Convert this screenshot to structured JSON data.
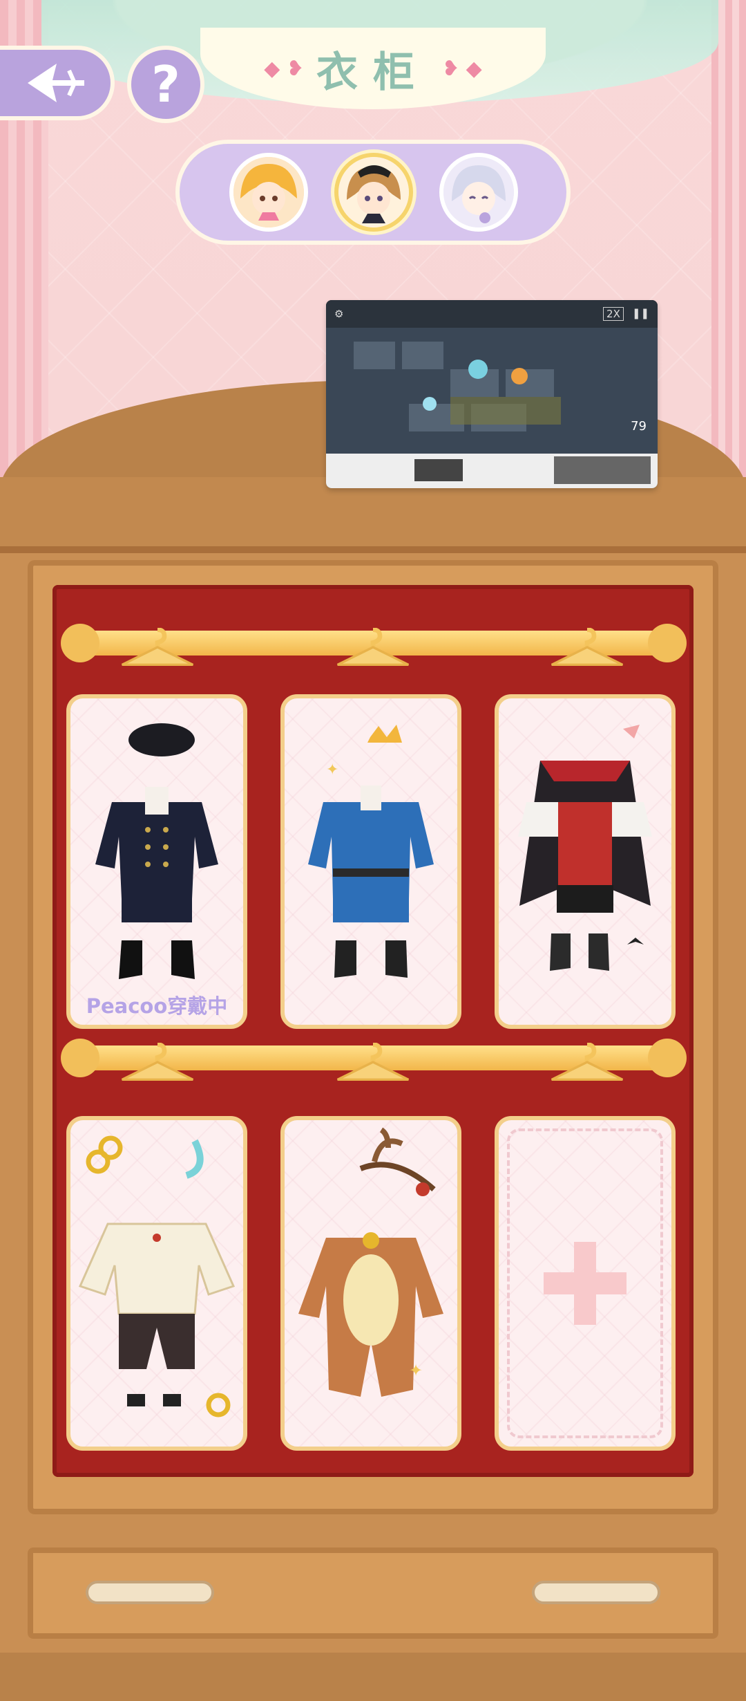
{
  "header": {
    "title": "衣柜"
  },
  "characters": [
    {
      "name": "character-blonde"
    },
    {
      "name": "character-brunette",
      "selected": true
    },
    {
      "name": "character-silver"
    }
  ],
  "video": {
    "speed": "2X",
    "counter": "79"
  },
  "wardrobe": {
    "outfits": [
      {
        "name": "dark-navy-uniform",
        "status_label": "Peacoo穿戴中"
      },
      {
        "name": "blue-royal-uniform"
      },
      {
        "name": "vampire-outfit"
      },
      {
        "name": "white-chinese-outfit"
      },
      {
        "name": "reindeer-onesie"
      },
      {
        "name": "empty-slot"
      }
    ]
  },
  "colors": {
    "accent": "#b9a3dd",
    "wood": "#c98f54",
    "interior": "#a8231f",
    "gold": "#f2bf5a"
  }
}
